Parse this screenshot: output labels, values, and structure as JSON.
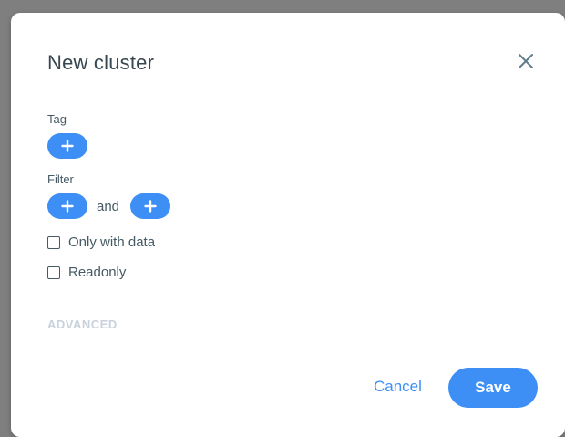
{
  "dialog": {
    "title": "New cluster",
    "close_icon": "close-icon"
  },
  "tag": {
    "label": "Tag",
    "add_icon": "plus-icon"
  },
  "filter": {
    "label": "Filter",
    "and_text": "and",
    "add_icon": "plus-icon"
  },
  "options": {
    "only_with_data": {
      "label": "Only with data",
      "checked": false
    },
    "readonly": {
      "label": "Readonly",
      "checked": false
    }
  },
  "advanced": {
    "label": "ADVANCED"
  },
  "actions": {
    "cancel_label": "Cancel",
    "save_label": "Save"
  },
  "colors": {
    "accent": "#3d8ff5",
    "text": "#455a64",
    "title": "#37474f",
    "muted": "#c9d2dc"
  }
}
